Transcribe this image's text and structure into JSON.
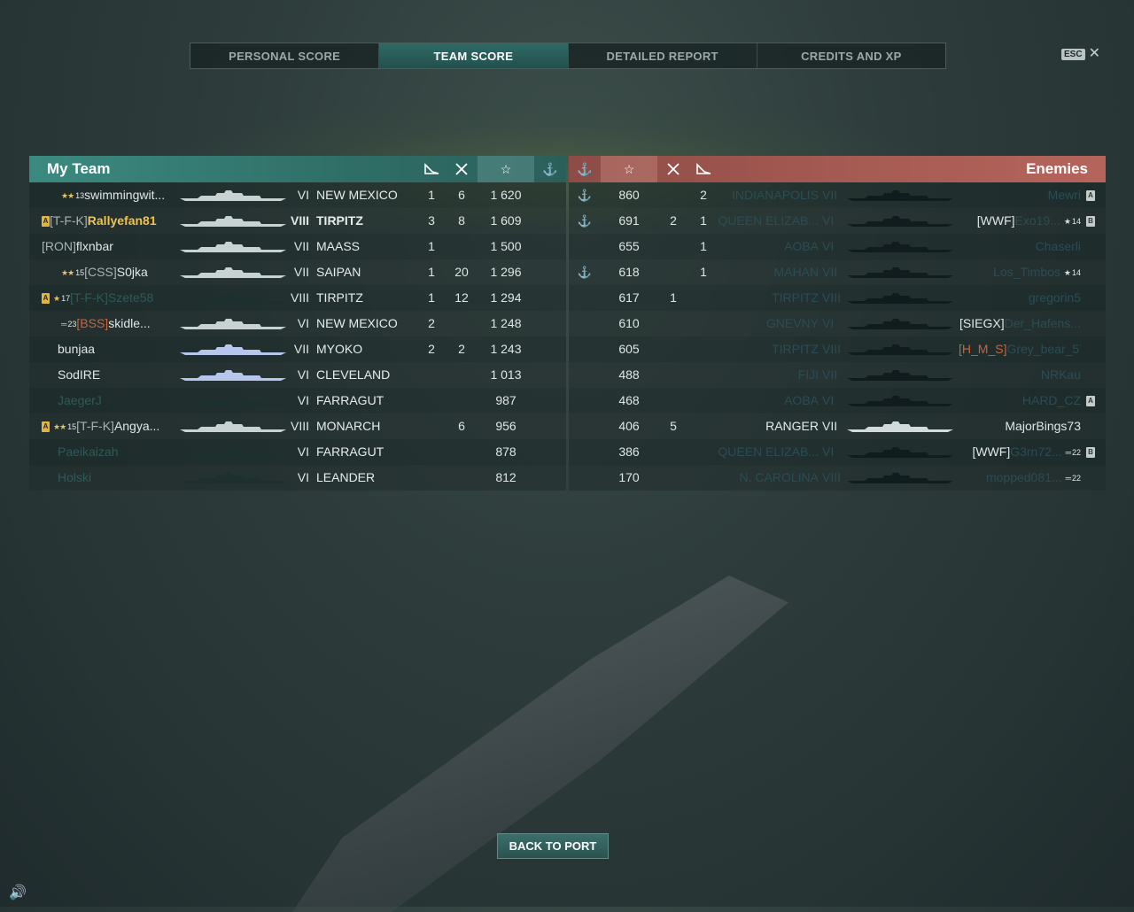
{
  "tabs": [
    {
      "label": "PERSONAL SCORE",
      "active": false
    },
    {
      "label": "TEAM SCORE",
      "active": true
    },
    {
      "label": "DETAILED REPORT",
      "active": false
    },
    {
      "label": "CREDITS AND XP",
      "active": false
    }
  ],
  "esc_label": "ESC",
  "my_team": {
    "title": "My Team",
    "rows": [
      {
        "badge": "",
        "chev": "★★",
        "rank": "13",
        "clan": "",
        "name": "swimmingwit...",
        "tier": "VI",
        "ship": "NEW MEXICO",
        "planes": "1",
        "ships": "6",
        "xp": "1 620",
        "cap": "",
        "dim": false
      },
      {
        "badge": "A",
        "chev": "",
        "rank": "",
        "clan": "[T-F-K]",
        "name": "Rallyefan81",
        "tier": "VIII",
        "ship": "TIRPITZ",
        "planes": "3",
        "ships": "8",
        "xp": "1 609",
        "cap": "",
        "dim": false,
        "self": true
      },
      {
        "badge": "",
        "chev": "",
        "rank": "",
        "clan": "[RON]",
        "name": "flxnbar",
        "tier": "VII",
        "ship": "MAASS",
        "planes": "1",
        "ships": "",
        "xp": "1 500",
        "cap": "",
        "dim": false
      },
      {
        "badge": "",
        "chev": "★★",
        "rank": "15",
        "clan": "[CSS]",
        "name": "S0jka",
        "tier": "VII",
        "ship": "SAIPAN",
        "planes": "1",
        "ships": "20",
        "xp": "1 296",
        "cap": "",
        "dim": false
      },
      {
        "badge": "A",
        "chev": "★",
        "rank": "17",
        "clan": "[T-F-K]",
        "name": "Szete58",
        "tier": "VIII",
        "ship": "TIRPITZ",
        "planes": "1",
        "ships": "12",
        "xp": "1 294",
        "cap": "",
        "dim": true
      },
      {
        "badge": "",
        "chev": "═",
        "rank": "23",
        "clan": "[BSS]",
        "name": "skidle...",
        "tier": "VI",
        "ship": "NEW MEXICO",
        "planes": "2",
        "ships": "",
        "xp": "1 248",
        "cap": "",
        "dim": false,
        "clan_red": true
      },
      {
        "badge": "",
        "chev": "",
        "rank": "",
        "clan": "",
        "name": "bunjaa",
        "tier": "VII",
        "ship": "MYOKO",
        "planes": "2",
        "ships": "2",
        "xp": "1 243",
        "cap": "",
        "dim": false
      },
      {
        "badge": "",
        "chev": "",
        "rank": "",
        "clan": "",
        "name": "SodIRE",
        "tier": "VI",
        "ship": "CLEVELAND",
        "planes": "",
        "ships": "",
        "xp": "1 013",
        "cap": "",
        "dim": false
      },
      {
        "badge": "",
        "chev": "",
        "rank": "",
        "clan": "",
        "name": "JaegerJ",
        "tier": "VI",
        "ship": "FARRAGUT",
        "planes": "",
        "ships": "",
        "xp": "987",
        "cap": "",
        "dim": true
      },
      {
        "badge": "A",
        "chev": "★★",
        "rank": "15",
        "clan": "[T-F-K]",
        "name": "Angya...",
        "tier": "VIII",
        "ship": "MONARCH",
        "planes": "",
        "ships": "6",
        "xp": "956",
        "cap": "",
        "dim": false
      },
      {
        "badge": "",
        "chev": "",
        "rank": "",
        "clan": "",
        "name": "Paeikaizah",
        "tier": "VI",
        "ship": "FARRAGUT",
        "planes": "",
        "ships": "",
        "xp": "878",
        "cap": "",
        "dim": true
      },
      {
        "badge": "",
        "chev": "",
        "rank": "",
        "clan": "",
        "name": "Holski",
        "tier": "VI",
        "ship": "LEANDER",
        "planes": "",
        "ships": "",
        "xp": "812",
        "cap": "",
        "dim": true
      }
    ]
  },
  "enemies": {
    "title": "Enemies",
    "rows": [
      {
        "cap": "⚓",
        "xp": "860",
        "ships": "",
        "planes": "2",
        "ship": "INDIANAPOLIS",
        "tier": "VII",
        "clan": "",
        "name": "Mewri",
        "chev": "",
        "rank": "",
        "badge": "A",
        "dim": true
      },
      {
        "cap": "⚓",
        "xp": "691",
        "ships": "2",
        "planes": "1",
        "ship": "QUEEN ELIZAB...",
        "tier": "VI",
        "clan": "[WWF]",
        "name": "Exo19...",
        "chev": "★",
        "rank": "14",
        "badge": "B",
        "dim": true
      },
      {
        "cap": "",
        "xp": "655",
        "ships": "",
        "planes": "1",
        "ship": "AOBA",
        "tier": "VI",
        "clan": "",
        "name": "Chaserli",
        "chev": "",
        "rank": "",
        "badge": "",
        "dim": true
      },
      {
        "cap": "⚓",
        "xp": "618",
        "ships": "",
        "planes": "1",
        "ship": "MAHAN",
        "tier": "VII",
        "clan": "",
        "name": "Los_Timbos",
        "chev": "★",
        "rank": "14",
        "badge": "",
        "dim": true
      },
      {
        "cap": "",
        "xp": "617",
        "ships": "1",
        "planes": "",
        "ship": "TIRPITZ",
        "tier": "VIII",
        "clan": "",
        "name": "gregorin5",
        "chev": "",
        "rank": "",
        "badge": "",
        "dim": true
      },
      {
        "cap": "",
        "xp": "610",
        "ships": "",
        "planes": "",
        "ship": "GNEVNY",
        "tier": "VI",
        "clan": "[SIEGX]",
        "name": "Der_Hafens...",
        "chev": "",
        "rank": "",
        "badge": "",
        "dim": true
      },
      {
        "cap": "",
        "xp": "605",
        "ships": "",
        "planes": "",
        "ship": "TIRPITZ",
        "tier": "VIII",
        "clan": "[H_M_S]",
        "name": "Grey_bear_57",
        "chev": "",
        "rank": "",
        "badge": "",
        "dim": true,
        "clan_red": true
      },
      {
        "cap": "",
        "xp": "488",
        "ships": "",
        "planes": "",
        "ship": "FIJI",
        "tier": "VII",
        "clan": "",
        "name": "NRKau",
        "chev": "",
        "rank": "",
        "badge": "",
        "dim": true
      },
      {
        "cap": "",
        "xp": "468",
        "ships": "",
        "planes": "",
        "ship": "AOBA",
        "tier": "VI",
        "clan": "",
        "name": "HARD_CZ",
        "chev": "",
        "rank": "",
        "badge": "A",
        "dim": true
      },
      {
        "cap": "",
        "xp": "406",
        "ships": "5",
        "planes": "",
        "ship": "RANGER",
        "tier": "VII",
        "clan": "",
        "name": "MajorBings73",
        "chev": "",
        "rank": "",
        "badge": "",
        "dim": false
      },
      {
        "cap": "",
        "xp": "386",
        "ships": "",
        "planes": "",
        "ship": "QUEEN ELIZAB...",
        "tier": "VI",
        "clan": "[WWF]",
        "name": "G3rn72...",
        "chev": "═",
        "rank": "22",
        "badge": "B",
        "dim": true
      },
      {
        "cap": "",
        "xp": "170",
        "ships": "",
        "planes": "",
        "ship": "N. CAROLINA",
        "tier": "VIII",
        "clan": "",
        "name": "mopped081...",
        "chev": "═",
        "rank": "22",
        "badge": "",
        "dim": true
      }
    ]
  },
  "back_to_port": "BACK TO PORT",
  "colors": {
    "ally_header": "#3b8a80",
    "enemy_header": "#a45a52",
    "self_gold": "#f1c24c"
  },
  "icons": {
    "planes": "plane-icon",
    "ships": "ship-destroyed-icon",
    "xp": "star-icon",
    "cap": "anchor-icon"
  }
}
